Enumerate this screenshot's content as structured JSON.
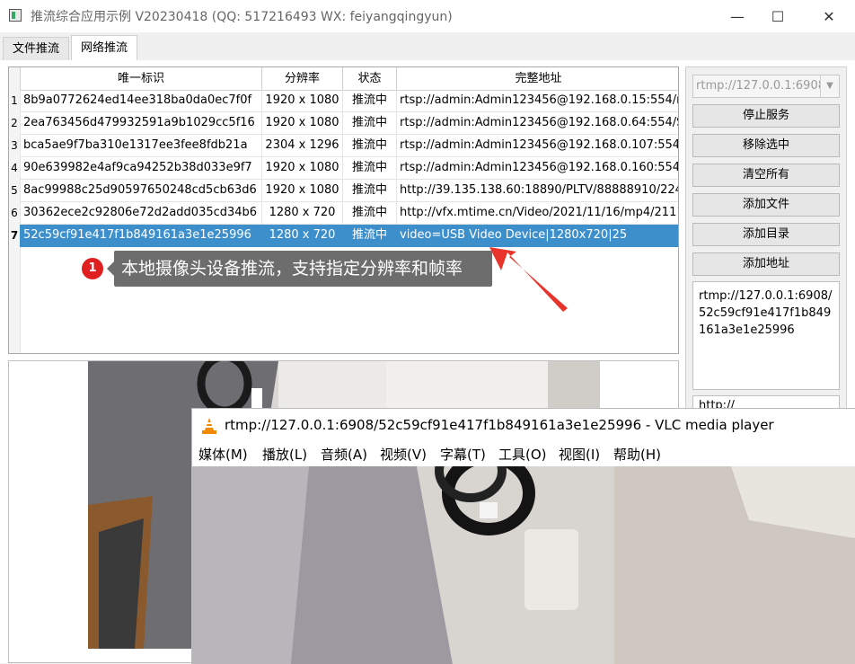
{
  "window": {
    "title": "推流综合应用示例 V20230418 (QQ: 517216493 WX: feiyangqingyun)",
    "minimize_glyph": "—",
    "maximize_glyph": "☐",
    "close_glyph": "✕"
  },
  "tabs": [
    {
      "label": "文件推流",
      "active": false
    },
    {
      "label": "网络推流",
      "active": true
    }
  ],
  "table": {
    "columns": [
      "唯一标识",
      "分辨率",
      "状态",
      "完整地址"
    ],
    "rows": [
      {
        "num": "1",
        "id": "8b9a0772624ed14ee318ba0da0ec7f0f",
        "res": "1920 x 1080",
        "status": "推流中",
        "url": "rtsp://admin:Admin123456@192.168.0.15:554/me"
      },
      {
        "num": "2",
        "id": "2ea763456d479932591a9b1029cc5f16",
        "res": "1920 x 1080",
        "status": "推流中",
        "url": "rtsp://admin:Admin123456@192.168.0.64:554/Str"
      },
      {
        "num": "3",
        "id": "bca5ae9f7ba310e1317ee3fee8fdb21a",
        "res": "2304 x 1296",
        "status": "推流中",
        "url": "rtsp://admin:Admin123456@192.168.0.107:554/c"
      },
      {
        "num": "4",
        "id": "90e639982e4af9ca94252b38d033e9f7",
        "res": "1920 x 1080",
        "status": "推流中",
        "url": "rtsp://admin:Admin123456@192.168.0.160:554/s"
      },
      {
        "num": "5",
        "id": "8ac99988c25d90597650248cd5cb63d6",
        "res": "1920 x 1080",
        "status": "推流中",
        "url": "http://39.135.138.60:18890/PLTV/88888910/224"
      },
      {
        "num": "6",
        "id": "30362ece2c92806e72d2add035cd34b6",
        "res": "1280 x 720",
        "status": "推流中",
        "url": "http://vfx.mtime.cn/Video/2021/11/16/mp4/2111"
      },
      {
        "num": "7",
        "id": "52c59cf91e417f1b849161a3e1e25996",
        "res": "1280 x 720",
        "status": "推流中",
        "url": "video=USB Video Device|1280x720|25"
      }
    ],
    "selected_row": 7
  },
  "sidebar": {
    "server_combo_value": "rtmp://127.0.0.1:6908",
    "buttons": [
      "停止服务",
      "移除选中",
      "清空所有",
      "添加文件",
      "添加目录",
      "添加地址"
    ],
    "address_text": "rtmp://127.0.0.1:6908/52c59cf91e417f1b849161a3e1e25996",
    "address_text_2": "http://"
  },
  "callout": {
    "number": "1",
    "text": "本地摄像头设备推流，支持指定分辨率和帧率"
  },
  "vlc": {
    "title": "rtmp://127.0.0.1:6908/52c59cf91e417f1b849161a3e1e25996 - VLC media player",
    "menu": [
      "媒体(M)",
      "播放(L)",
      "音频(A)",
      "视频(V)",
      "字幕(T)",
      "工具(O)",
      "视图(I)",
      "帮助(H)"
    ]
  },
  "colors": {
    "selection": "#3d8fcc",
    "callout_bg": "#6d6d6d",
    "callout_badge": "#e02020",
    "annotation_arrow": "#e8342a",
    "vlc_cone": "#f28a00"
  }
}
